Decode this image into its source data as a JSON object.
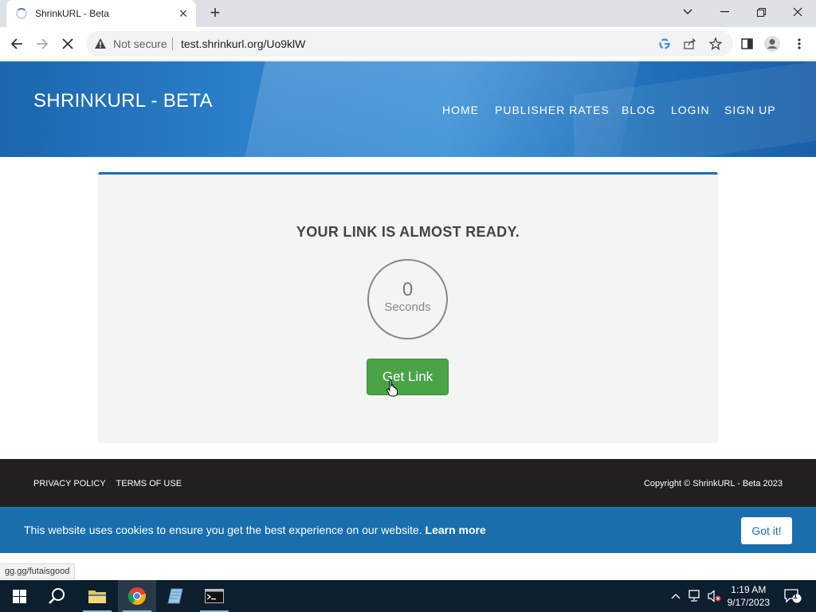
{
  "browser": {
    "tab_title": "ShrinkURL - Beta",
    "security_label": "Not secure",
    "url": "test.shrinkurl.org/Uo9klW",
    "status_url": "gg.gg/futaisgood"
  },
  "site": {
    "brand": "SHRINKURL - BETA",
    "nav": [
      "HOME",
      "PUBLISHER RATES",
      "BLOG",
      "LOGIN",
      "SIGN UP"
    ],
    "heading": "YOUR LINK IS ALMOST READY.",
    "countdown_value": "0",
    "countdown_unit": "Seconds",
    "get_link_label": "Get Link",
    "footer_links": [
      "PRIVACY POLICY",
      "TERMS OF USE"
    ],
    "copyright": "Copyright © ShrinkURL - Beta 2023",
    "cookie_message": "This website uses cookies to ensure you get the best experience on our website.",
    "cookie_learn_more": "Learn more",
    "cookie_button": "Got it!"
  },
  "taskbar": {
    "time": "1:19 AM",
    "date": "9/17/2023",
    "notification_count": "1"
  },
  "colors": {
    "header_blue": "#2f84cf",
    "accent_blue": "#1d6db5",
    "button_green": "#4aa447",
    "footer_dark": "#231f1e"
  }
}
